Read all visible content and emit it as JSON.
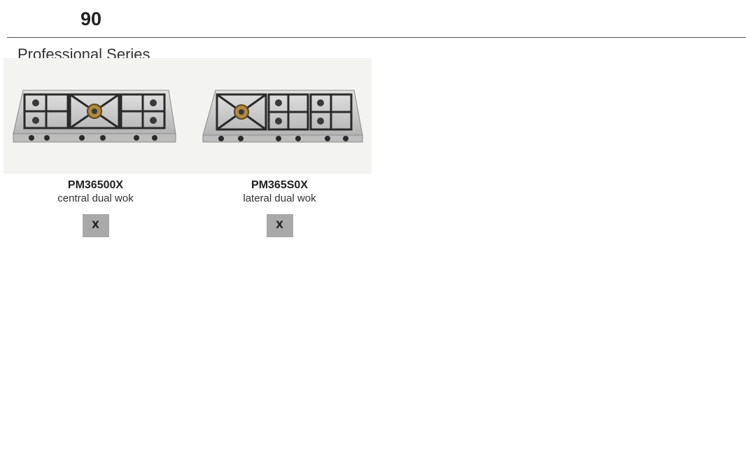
{
  "heading": {
    "size": "90"
  },
  "series": {
    "title": "Professional Series"
  },
  "products": [
    {
      "model": "PM36500X",
      "description": "central dual wok",
      "finish": "X",
      "wok_position": "center"
    },
    {
      "model": "PM365S0X",
      "description": "lateral dual wok",
      "finish": "X",
      "wok_position": "left"
    }
  ],
  "colors": {
    "finish_swatch": "#a9a9a9",
    "image_background": "#f3f3f2",
    "steel": "#c9c9c9",
    "brass": "#b08a3e"
  }
}
